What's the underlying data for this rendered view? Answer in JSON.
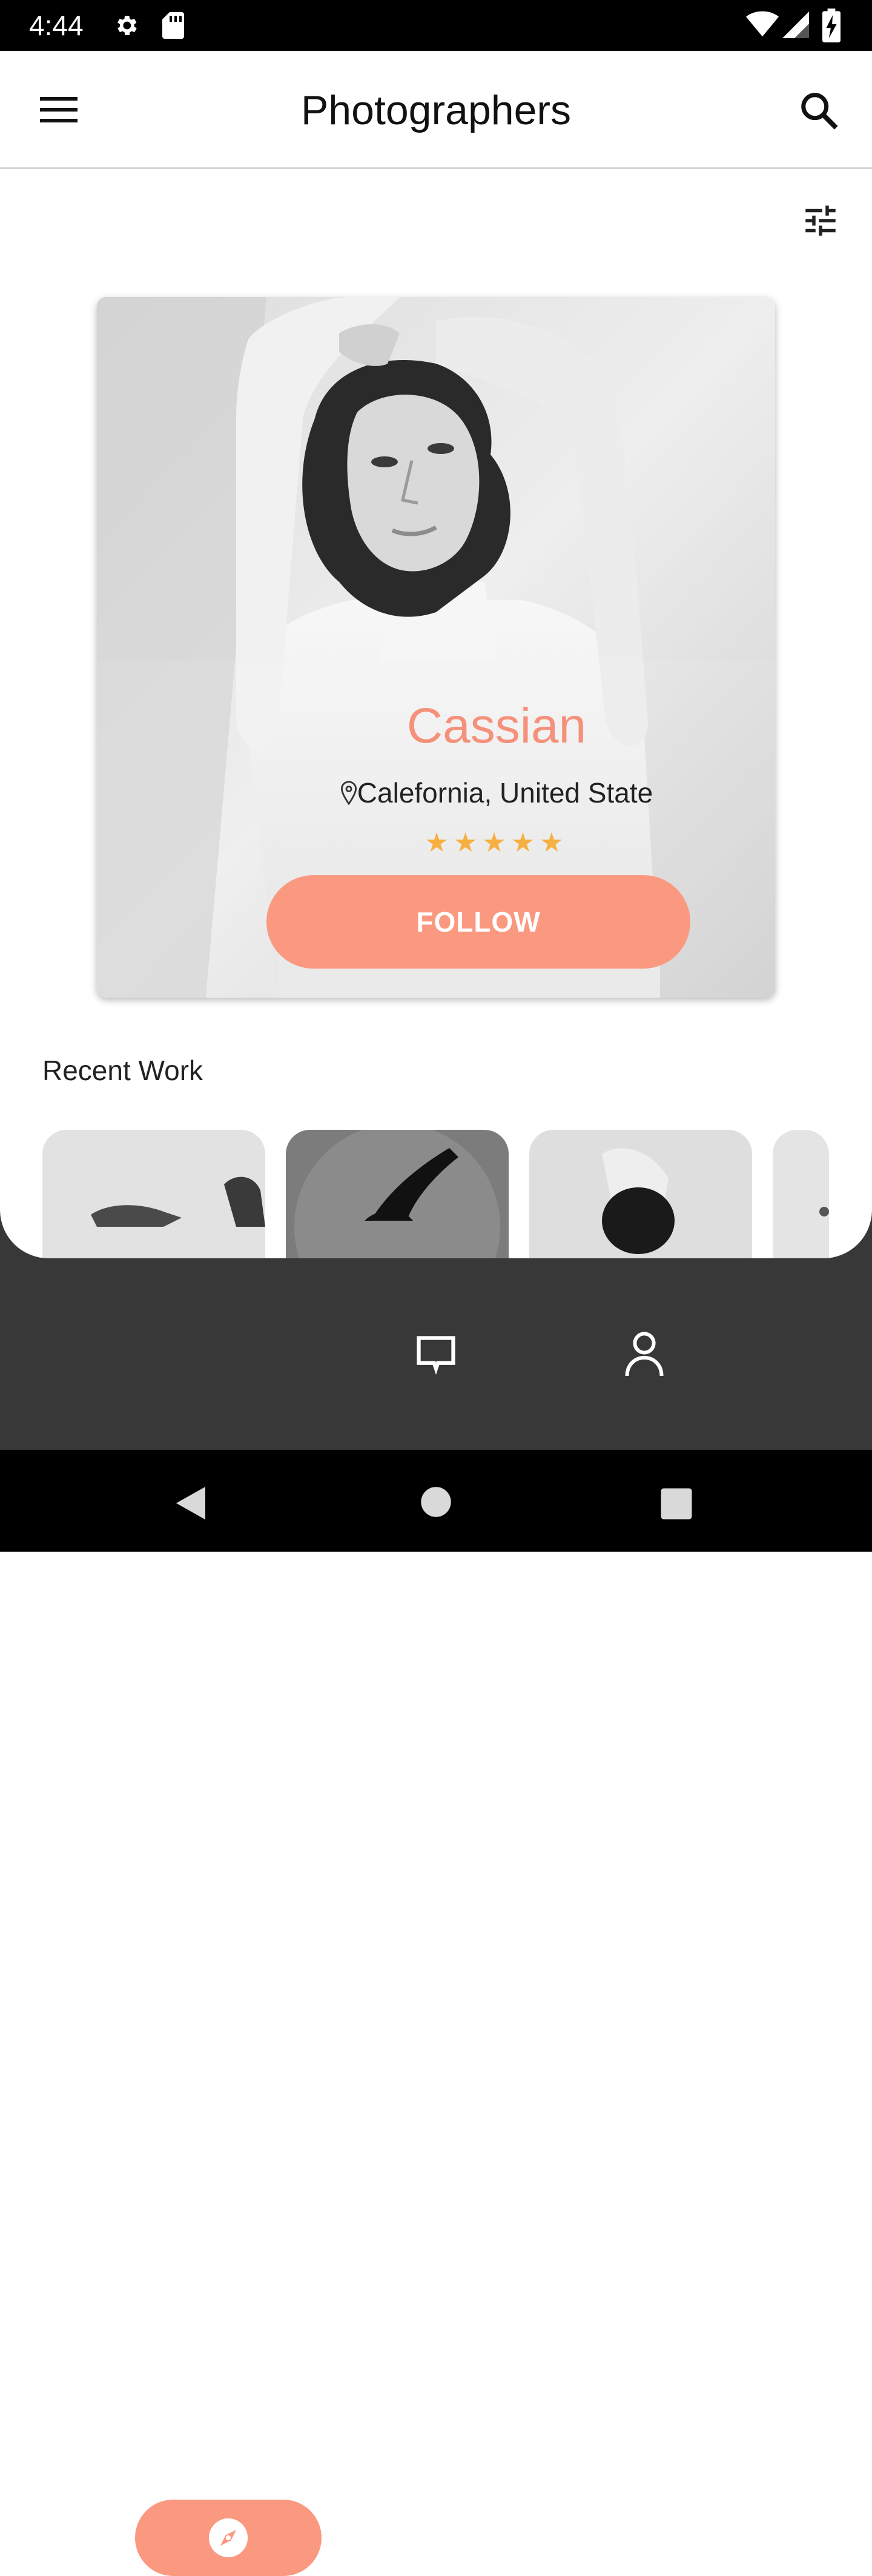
{
  "status_bar": {
    "time": "4:44"
  },
  "app_bar": {
    "title": "Photographers"
  },
  "profile": {
    "name": "Cassian",
    "location": "Calefornia, United State",
    "rating_stars": 5,
    "stars_text": "★★★★★",
    "follow_label": "FOLLOW"
  },
  "recent_work": {
    "title": "Recent Work",
    "thumbnail_count": 4
  },
  "bottom_nav": {
    "items": [
      "explore",
      "messages",
      "profile"
    ],
    "selected": "explore"
  },
  "colors": {
    "accent": "#fb9880",
    "name_color": "#f5917b",
    "star_color": "#f6b042",
    "bottom_area": "#383838"
  }
}
